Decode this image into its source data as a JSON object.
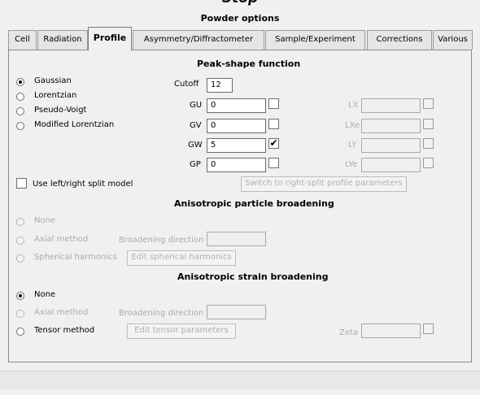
{
  "cut_off_title": "Stop",
  "window_title": "Powder options",
  "tabs": [
    "Cell",
    "Radiation",
    "Profile",
    "Asymmetry/Diffractometer",
    "Sample/Experiment",
    "Corrections",
    "Various"
  ],
  "active_tab": "Profile",
  "peak_shape": {
    "title": "Peak-shape function",
    "options": [
      "Gaussian",
      "Lorentzian",
      "Pseudo-Voigt",
      "Modified Lorentzian"
    ],
    "selected": "Gaussian",
    "cutoff_label": "Cutoff",
    "cutoff_value": "12",
    "params": [
      {
        "label": "GU",
        "value": "0",
        "checked": false
      },
      {
        "label": "GV",
        "value": "0",
        "checked": false
      },
      {
        "label": "GW",
        "value": "5",
        "checked": true
      },
      {
        "label": "GP",
        "value": "0",
        "checked": false
      }
    ],
    "split_params": [
      "LX",
      "LXe",
      "LY",
      "LYe"
    ],
    "split_checkbox_label": "Use left/right split model",
    "split_button": "Switch to right-split profile parameters"
  },
  "particle_broadening": {
    "title": "Anisotropic particle broadening",
    "options": [
      "None",
      "Axial method",
      "Spherical harmonics"
    ],
    "direction_label": "Broadening direction",
    "button": "Edit spherical harmonics"
  },
  "strain_broadening": {
    "title": "Anisotropic strain broadening",
    "options": [
      "None",
      "Axial method",
      "Tensor method"
    ],
    "selected": "None",
    "direction_label": "Broadening direction",
    "button": "Edit tensor parameters",
    "zeta_label": "Zeta"
  },
  "icons": [
    "checkmark-icon"
  ]
}
